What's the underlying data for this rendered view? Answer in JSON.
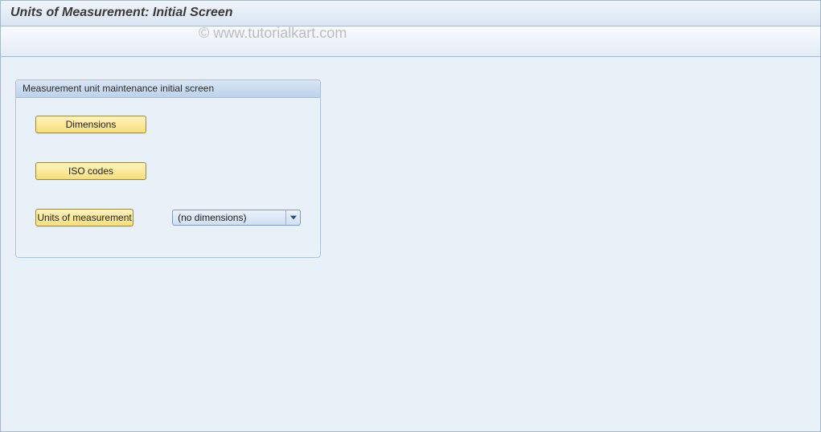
{
  "header": {
    "title": "Units of Measurement: Initial Screen"
  },
  "watermark": "© www.tutorialkart.com",
  "groupbox": {
    "title": "Measurement unit maintenance initial screen",
    "buttons": {
      "dimensions": "Dimensions",
      "iso_codes": "ISO codes",
      "uom": "Units of measurement"
    },
    "select": {
      "selected": "(no dimensions)"
    }
  }
}
